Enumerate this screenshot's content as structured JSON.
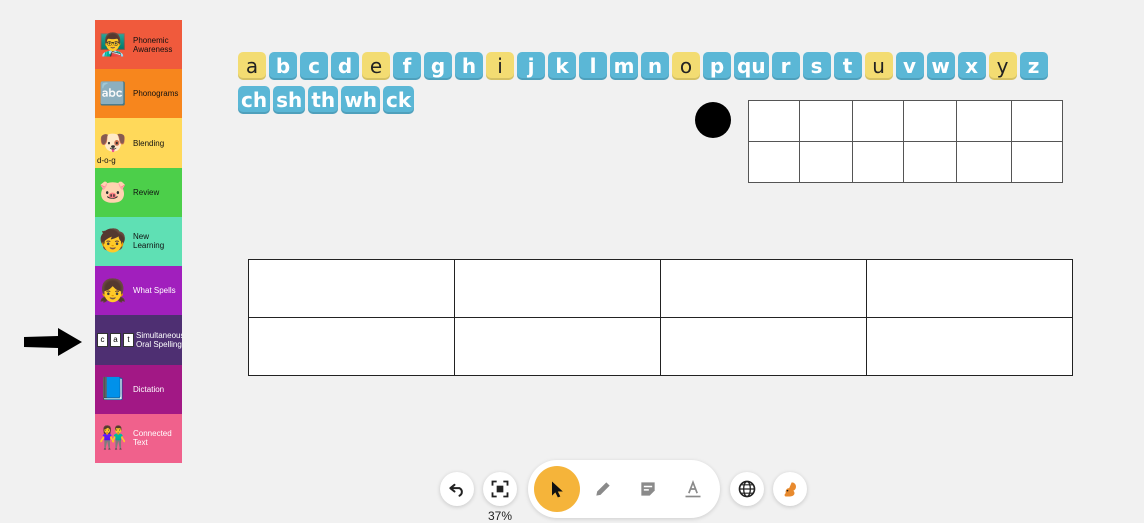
{
  "sidebar": {
    "items": [
      {
        "label": "Phonemic Awareness",
        "color": "#f05a3c",
        "icon": "teacher-icon"
      },
      {
        "label": "Phonograms",
        "color": "#f7861d",
        "icon": "abc-blocks-icon"
      },
      {
        "label": "Blending",
        "color": "#ffd95a",
        "icon": "dog-icon",
        "sub": "d-o-g"
      },
      {
        "label": "Review",
        "color": "#4ccf4a",
        "icon": "cards-icon"
      },
      {
        "label": "New Learning",
        "color": "#5fe0b4",
        "icon": "boy-icon"
      },
      {
        "label": "What Spells",
        "color": "#a11fbd",
        "icon": "girl-writing-icon"
      },
      {
        "label": "Simultaneous Oral Spelling",
        "color": "#4e2f72",
        "icon": "cat-letters-icon",
        "letters": [
          "c",
          "a",
          "t"
        ]
      },
      {
        "label": "Dictation",
        "color": "#a21885",
        "icon": "notebook-icon"
      },
      {
        "label": "Connected Text",
        "color": "#f0618c",
        "icon": "kids-reading-icon"
      }
    ]
  },
  "tiles": {
    "row1": [
      {
        "t": "a",
        "v": true
      },
      {
        "t": "b",
        "v": false
      },
      {
        "t": "c",
        "v": false
      },
      {
        "t": "d",
        "v": false
      },
      {
        "t": "e",
        "v": true
      },
      {
        "t": "f",
        "v": false
      },
      {
        "t": "g",
        "v": false
      },
      {
        "t": "h",
        "v": false
      },
      {
        "t": "i",
        "v": true
      },
      {
        "t": "j",
        "v": false
      },
      {
        "t": "k",
        "v": false
      },
      {
        "t": "l",
        "v": false
      },
      {
        "t": "m",
        "v": false
      },
      {
        "t": "n",
        "v": false
      },
      {
        "t": "o",
        "v": true
      },
      {
        "t": "p",
        "v": false
      },
      {
        "t": "qu",
        "v": false
      },
      {
        "t": "r",
        "v": false
      },
      {
        "t": "s",
        "v": false
      },
      {
        "t": "t",
        "v": false
      },
      {
        "t": "u",
        "v": true
      },
      {
        "t": "v",
        "v": false
      },
      {
        "t": "w",
        "v": false
      },
      {
        "t": "x",
        "v": false
      },
      {
        "t": "y",
        "v": true
      },
      {
        "t": "z",
        "v": false
      }
    ],
    "row2": [
      {
        "t": "ch",
        "v": false
      },
      {
        "t": "sh",
        "v": false
      },
      {
        "t": "th",
        "v": false
      },
      {
        "t": "wh",
        "v": false
      },
      {
        "t": "ck",
        "v": false
      }
    ]
  },
  "toolbar": {
    "zoom": "37%",
    "accent": "#f5b43a",
    "undo_icon": "undo-icon",
    "fit_icon": "fit-screen-icon",
    "select_icon": "cursor-icon",
    "pen_icon": "pencil-icon",
    "note_icon": "sticky-note-icon",
    "text_icon": "text-icon",
    "globe_icon": "globe-icon",
    "squirrel_icon": "squirrel-icon"
  }
}
